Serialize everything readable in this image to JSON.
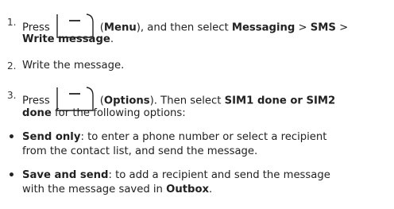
{
  "steps": [
    {
      "number": "1.",
      "pre": "Press",
      "key_name": "Menu",
      "mid": "), and then select",
      "path_a": "Messaging",
      "sep1": " > ",
      "path_b": "SMS",
      "sep2": " >",
      "path_c": "Write message",
      "end": "."
    },
    {
      "number": "2.",
      "text": "Write the message."
    },
    {
      "number": "3.",
      "pre": "Press",
      "key_name": "Options",
      "mid": "). Then select",
      "path_a": "SIM1 done or SIM2",
      "path_c": "done",
      "line2_rest": " for the following options:"
    }
  ],
  "bullets": [
    {
      "title": "Send only",
      "line1_rest": ": to enter a phone number or select a recipient",
      "line2": "from the contact list, and send the message."
    },
    {
      "title": "Save and send",
      "line1_rest": ": to add a recipient and send the message",
      "line2_pre": "with the message saved in ",
      "line2_bold": "Outbox",
      "line2_end": "."
    }
  ],
  "symbols": {
    "bullet": "•",
    "open_paren": "(",
    "softkey_icon": "softkey-icon"
  }
}
